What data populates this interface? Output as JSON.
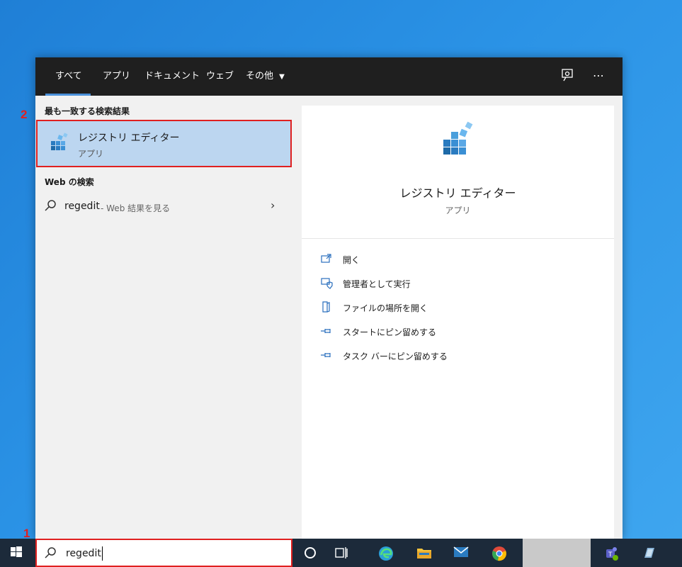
{
  "tabs": [
    {
      "label": "すべて"
    },
    {
      "label": "アプリ"
    },
    {
      "label": "ドキュメント"
    },
    {
      "label": "ウェブ"
    },
    {
      "label": "その他"
    }
  ],
  "left": {
    "best_match_heading": "最も一致する検索結果",
    "best_match": {
      "title": "レジストリ エディター",
      "subtitle": "アプリ"
    },
    "web_heading": "Web の検索",
    "web_result": {
      "query": "regedit",
      "suffix": " - Web 結果を見る"
    }
  },
  "detail": {
    "title": "レジストリ エディター",
    "subtitle": "アプリ",
    "actions": [
      {
        "label": "開く"
      },
      {
        "label": "管理者として実行"
      },
      {
        "label": "ファイルの場所を開く"
      },
      {
        "label": "スタートにピン留めする"
      },
      {
        "label": "タスク バーにピン留めする"
      }
    ]
  },
  "search": {
    "value": "regedit"
  },
  "annotations": {
    "one": "1",
    "two": "2"
  },
  "colors": {
    "accent": "#4a90d9",
    "highlight": "#bcd6f0",
    "callout": "#e02020",
    "tabbar": "#1f1f1f"
  }
}
